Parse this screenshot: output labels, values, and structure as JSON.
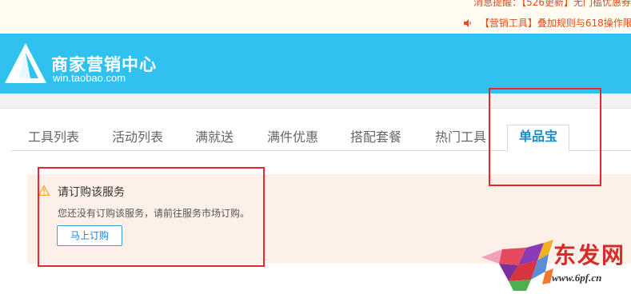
{
  "notices": {
    "line1": "消息提醒：【526更新】无门槛优惠券",
    "line2": "【营销工具】叠加规则与618操作限"
  },
  "header": {
    "brand_name": "商家营销中心",
    "brand_url": "win.taobao.com",
    "bg_color": "#30c1ee"
  },
  "tabs": [
    {
      "label": "工具列表"
    },
    {
      "label": "活动列表"
    },
    {
      "label": "满就送"
    },
    {
      "label": "满件优惠"
    },
    {
      "label": "搭配套餐"
    },
    {
      "label": "热门工具"
    },
    {
      "label": "单品宝"
    }
  ],
  "active_tab": "单品宝",
  "alert": {
    "icon": "warning-icon",
    "title": "请订购该服务",
    "description": "您还没有订购该服务，请前往服务市场订购。",
    "button_label": "马上订购"
  },
  "watermark": {
    "text": "东发网",
    "url": "www.6pf.cn"
  },
  "colors": {
    "accent": "#1b8dc9",
    "annotation_red": "#e8262b",
    "alert_bg": "#fdf0e8"
  }
}
